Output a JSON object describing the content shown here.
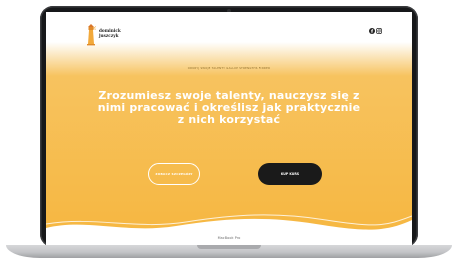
{
  "device": {
    "model_label": "MacBook Pro"
  },
  "site": {
    "brand": {
      "line1": "dominick",
      "line2": "juszczyk"
    },
    "social": {
      "facebook_icon": "facebook-icon",
      "instagram_icon": "instagram-icon"
    },
    "eyebrow": "ODKRYJ SWOJE TALENTY GALLUP STRENGTHS FINDER",
    "headline": "Zrozumiesz swoje talenty, nauczysz się z nimi pracować i określisz jak praktycznie z nich korzystać",
    "buttons": {
      "details_label": "ZOBACZ SZCZEGÓŁY",
      "buy_label": "KUP KURS"
    }
  },
  "colors": {
    "accent": "#f6b63f",
    "dark": "#1a1a1a",
    "white": "#ffffff"
  }
}
